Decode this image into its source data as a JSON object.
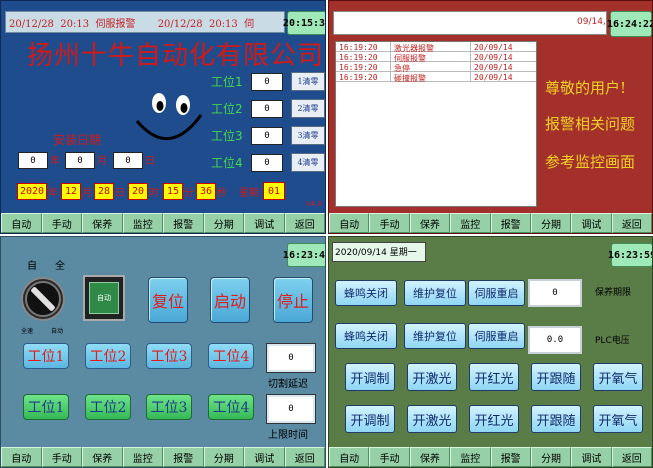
{
  "nav": [
    "自动",
    "手动",
    "保养",
    "监控",
    "报警",
    "分期",
    "调试",
    "返回"
  ],
  "p1": {
    "ticker": "20/12/28  20:13  伺服报警       20/12/28  20:13  伺",
    "clock": "20:15:36",
    "title": "扬州十牛自动化有限公司",
    "stations": [
      {
        "label": "工位1",
        "value": "0",
        "btn": "1清零"
      },
      {
        "label": "工位2",
        "value": "0",
        "btn": "2清零"
      },
      {
        "label": "工位3",
        "value": "0",
        "btn": "3清零"
      },
      {
        "label": "工位4",
        "value": "0",
        "btn": "4清零"
      }
    ],
    "install_label": "安装日期",
    "install": {
      "y": "0",
      "y_unit": "年",
      "m": "0",
      "m_unit": "月",
      "d": "0",
      "d_unit": "日"
    },
    "dt": {
      "year": "2020",
      "year_unit": "年",
      "month": "12",
      "month_unit": "月",
      "day": "28",
      "day_unit": "日",
      "hour": "20",
      "hour_unit": "时",
      "min": "15",
      "min_unit": "分",
      "sec": "36",
      "sec_unit": "秒",
      "week_label": "星期",
      "week": "01"
    },
    "version": "V4.0"
  },
  "p2": {
    "ticker": "09/14,",
    "clock": "16:24:22",
    "alarms": [
      {
        "time": "16:19:20",
        "msg": "激光器报警",
        "date": "20/09/14"
      },
      {
        "time": "16:19:20",
        "msg": "伺服报警",
        "date": "20/09/14"
      },
      {
        "time": "16:19:20",
        "msg": "急停",
        "date": "20/09/14"
      },
      {
        "time": "16:19:20",
        "msg": "碰撞报警",
        "date": "20/09/14"
      }
    ],
    "msg1": "尊敬的用户!",
    "msg2": "报警相关问题",
    "msg3": "参考监控画面"
  },
  "p3": {
    "clock": "16:23:48",
    "mode_left": "自",
    "mode_right": "全",
    "knob_left": "全速",
    "knob_right": "自动",
    "auto_btn": "自动",
    "reset": "复位",
    "start": "启动",
    "stop": "停止",
    "top_stations": [
      "工位1",
      "工位2",
      "工位3",
      "工位4"
    ],
    "bottom_stations": [
      "工位1",
      "工位2",
      "工位3",
      "工位4"
    ],
    "cut_delay_value": "0",
    "cut_delay_label": "切割延迟",
    "limit_value": "0",
    "limit_label": "上限时间"
  },
  "p4": {
    "header": "2020/09/14 星期一",
    "clock": "16:23:59",
    "row1": [
      "蜂鸣关闭",
      "维护复位",
      "伺服重启"
    ],
    "row1_value": "0",
    "row1_label": "保养期限",
    "row2": [
      "蜂鸣关闭",
      "维护复位",
      "伺服重启"
    ],
    "row2_value": "0.0",
    "row2_label": "PLC电压",
    "row3": [
      "开调制",
      "开激光",
      "开红光",
      "开跟随",
      "开氧气"
    ],
    "row4": [
      "开调制",
      "开激光",
      "开红光",
      "开跟随",
      "开氧气"
    ]
  },
  "colors": {
    "p1_bg": "#1f4c8c",
    "p2_bg": "#a3302a",
    "p3_bg": "#5b8aa3",
    "p4_bg": "#5a7d48",
    "nav": "#96d0a6"
  }
}
